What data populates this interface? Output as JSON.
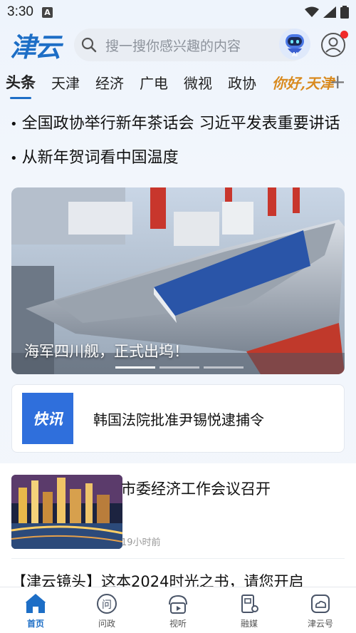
{
  "status_bar": {
    "time": "3:30",
    "notification_letter": "A"
  },
  "header": {
    "logo": "津云",
    "search_placeholder": "搜一搜你感兴趣的内容",
    "robot_label": "AI"
  },
  "tabs": {
    "items": [
      "头条",
      "天津",
      "经济",
      "广电",
      "微视",
      "政协"
    ],
    "special": "你好,天津",
    "active": "头条",
    "plus": "+"
  },
  "headlines": [
    "全国政协举行新年茶话会 习近平发表重要讲话",
    "从新年贺词看中国温度"
  ],
  "banner": {
    "caption": "海军四川舰，正式出坞！",
    "slides": 3,
    "active_slide": 1
  },
  "flash": {
    "badge": "快讯",
    "text": "韩国法院批准尹锡悦逮捕令"
  },
  "news": [
    {
      "title": "市委经济工作会议召开",
      "time": "19小时前"
    },
    {
      "title": "【津云镜头】这本2024时光之书，请您开启"
    }
  ],
  "bottom_nav": [
    {
      "label": "首页",
      "icon": "home-icon"
    },
    {
      "label": "问政",
      "icon": "ask-icon"
    },
    {
      "label": "视听",
      "icon": "tv-icon"
    },
    {
      "label": "融媒",
      "icon": "media-icon"
    },
    {
      "label": "津云号",
      "icon": "cloud-account-icon"
    }
  ],
  "colors": {
    "accent": "#1d6ec6",
    "flash_badge": "#2f6fdc",
    "notification": "#f02a2a",
    "special_tab": "#d98a1e"
  }
}
